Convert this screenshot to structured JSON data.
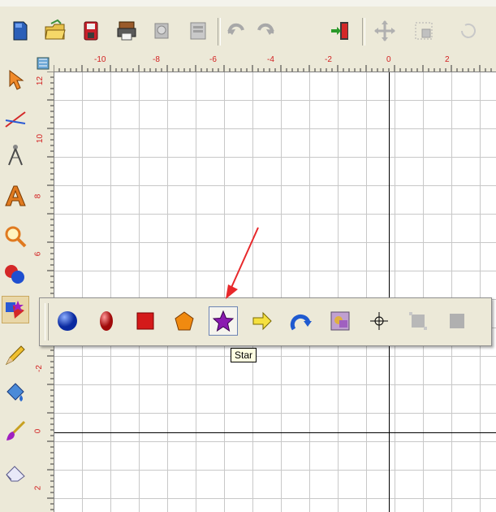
{
  "toolbar": {
    "buttons": [
      {
        "name": "new-document-icon"
      },
      {
        "name": "open-folder-icon"
      },
      {
        "name": "save-icon"
      },
      {
        "name": "print-icon"
      },
      {
        "name": "print-preview-icon"
      },
      {
        "name": "export-icon"
      },
      {
        "name": "undo-icon"
      },
      {
        "name": "redo-icon"
      },
      {
        "name": "exit-icon"
      },
      {
        "name": "move-icon"
      },
      {
        "name": "resize-icon"
      },
      {
        "name": "rotate-icon"
      }
    ]
  },
  "ruler": {
    "horizontal_labels": [
      "-10",
      "-8",
      "-6",
      "-4",
      "-2",
      "0",
      "2"
    ],
    "vertical_labels": [
      "12",
      "10",
      "8",
      "6",
      "-2",
      "0",
      "2"
    ]
  },
  "left_tools": [
    {
      "name": "pointer-tool-icon"
    },
    {
      "name": "line-tool-icon"
    },
    {
      "name": "compass-tool-icon"
    },
    {
      "name": "text-tool-icon"
    },
    {
      "name": "zoom-tool-icon"
    },
    {
      "name": "circles-tool-icon"
    },
    {
      "name": "shapes-tool-icon"
    },
    {
      "name": "pencil-tool-icon"
    },
    {
      "name": "fill-tool-icon"
    },
    {
      "name": "brush-tool-icon"
    },
    {
      "name": "eraser-tool-icon"
    }
  ],
  "palette": {
    "items": [
      {
        "name": "circle-shape-icon"
      },
      {
        "name": "ellipse-shape-icon"
      },
      {
        "name": "square-shape-icon"
      },
      {
        "name": "pentagon-shape-icon"
      },
      {
        "name": "star-shape-icon"
      },
      {
        "name": "arrow-shape-icon"
      },
      {
        "name": "curved-arrow-shape-icon"
      },
      {
        "name": "picture-shape-icon"
      },
      {
        "name": "crosshair-shape-icon"
      },
      {
        "name": "shape-disabled-icon"
      },
      {
        "name": "shape-disabled-icon"
      }
    ],
    "hovered": "star-shape-icon"
  },
  "tooltip": {
    "text": "Star"
  },
  "colors": {
    "annotation_arrow": "#e8282b",
    "ruler_label": "#d22020"
  }
}
